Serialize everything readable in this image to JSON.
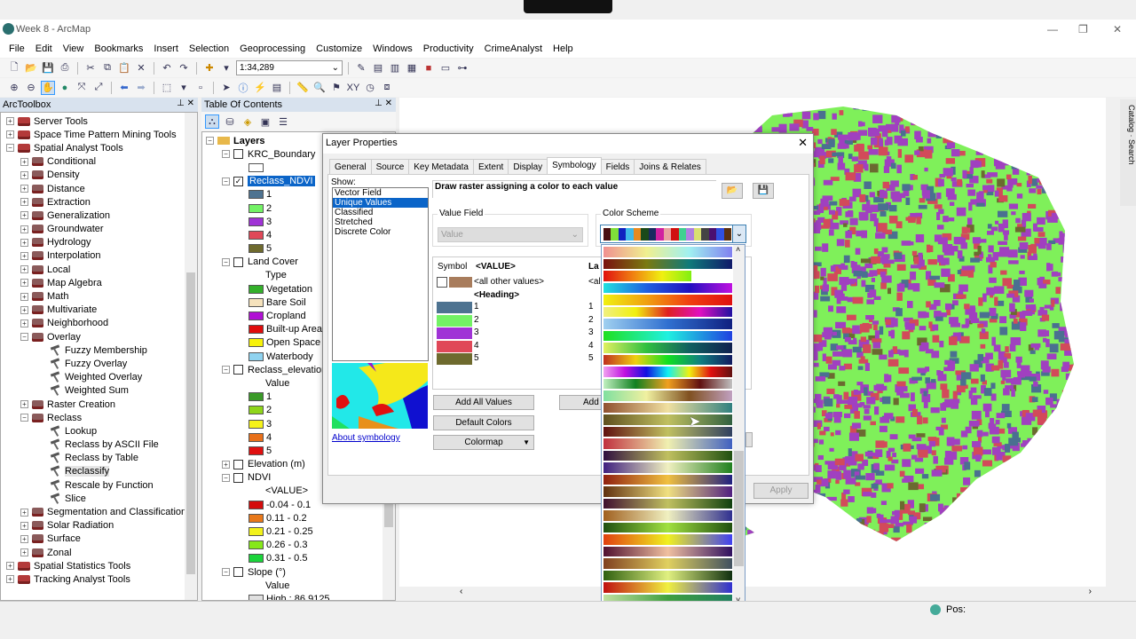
{
  "window": {
    "title": "Week 8 - ArcMap",
    "minimize": "—",
    "restore": "❐",
    "close": "✕"
  },
  "menu": [
    "File",
    "Edit",
    "View",
    "Bookmarks",
    "Insert",
    "Selection",
    "Geoprocessing",
    "Customize",
    "Windows",
    "Productivity",
    "CrimeAnalyst",
    "Help"
  ],
  "toolbar": {
    "scale": "1:34,289"
  },
  "arctoolbox": {
    "title": "ArcToolbox",
    "items": [
      {
        "label": "Server Tools",
        "level": 0,
        "type": "box",
        "exp": "+"
      },
      {
        "label": "Space Time Pattern Mining Tools",
        "level": 0,
        "type": "box",
        "exp": "+"
      },
      {
        "label": "Spatial Analyst Tools",
        "level": 0,
        "type": "box",
        "exp": "−"
      },
      {
        "label": "Conditional",
        "level": 1,
        "type": "set",
        "exp": "+"
      },
      {
        "label": "Density",
        "level": 1,
        "type": "set",
        "exp": "+"
      },
      {
        "label": "Distance",
        "level": 1,
        "type": "set",
        "exp": "+"
      },
      {
        "label": "Extraction",
        "level": 1,
        "type": "set",
        "exp": "+"
      },
      {
        "label": "Generalization",
        "level": 1,
        "type": "set",
        "exp": "+"
      },
      {
        "label": "Groundwater",
        "level": 1,
        "type": "set",
        "exp": "+"
      },
      {
        "label": "Hydrology",
        "level": 1,
        "type": "set",
        "exp": "+"
      },
      {
        "label": "Interpolation",
        "level": 1,
        "type": "set",
        "exp": "+"
      },
      {
        "label": "Local",
        "level": 1,
        "type": "set",
        "exp": "+"
      },
      {
        "label": "Map Algebra",
        "level": 1,
        "type": "set",
        "exp": "+"
      },
      {
        "label": "Math",
        "level": 1,
        "type": "set",
        "exp": "+"
      },
      {
        "label": "Multivariate",
        "level": 1,
        "type": "set",
        "exp": "+"
      },
      {
        "label": "Neighborhood",
        "level": 1,
        "type": "set",
        "exp": "+"
      },
      {
        "label": "Overlay",
        "level": 1,
        "type": "set",
        "exp": "−"
      },
      {
        "label": "Fuzzy Membership",
        "level": 2,
        "type": "tool"
      },
      {
        "label": "Fuzzy Overlay",
        "level": 2,
        "type": "tool"
      },
      {
        "label": "Weighted Overlay",
        "level": 2,
        "type": "tool"
      },
      {
        "label": "Weighted Sum",
        "level": 2,
        "type": "tool"
      },
      {
        "label": "Raster Creation",
        "level": 1,
        "type": "set",
        "exp": "+"
      },
      {
        "label": "Reclass",
        "level": 1,
        "type": "set",
        "exp": "−"
      },
      {
        "label": "Lookup",
        "level": 2,
        "type": "tool"
      },
      {
        "label": "Reclass by ASCII File",
        "level": 2,
        "type": "tool"
      },
      {
        "label": "Reclass by Table",
        "level": 2,
        "type": "tool"
      },
      {
        "label": "Reclassify",
        "level": 2,
        "type": "tool",
        "hl": true
      },
      {
        "label": "Rescale by Function",
        "level": 2,
        "type": "tool"
      },
      {
        "label": "Slice",
        "level": 2,
        "type": "tool"
      },
      {
        "label": "Segmentation and Classification",
        "level": 1,
        "type": "set",
        "exp": "+"
      },
      {
        "label": "Solar Radiation",
        "level": 1,
        "type": "set",
        "exp": "+"
      },
      {
        "label": "Surface",
        "level": 1,
        "type": "set",
        "exp": "+"
      },
      {
        "label": "Zonal",
        "level": 1,
        "type": "set",
        "exp": "+"
      },
      {
        "label": "Spatial Statistics Tools",
        "level": 0,
        "type": "box",
        "exp": "+"
      },
      {
        "label": "Tracking Analyst Tools",
        "level": 0,
        "type": "box",
        "exp": "+"
      }
    ]
  },
  "toc": {
    "title": "Table Of Contents",
    "root": "Layers",
    "items": [
      {
        "kind": "layer",
        "label": "KRC_Boundary",
        "checked": false
      },
      {
        "kind": "sym",
        "label": "",
        "color": "#ffffff"
      },
      {
        "kind": "layer",
        "label": "Reclass_NDVI",
        "checked": true,
        "selected": true
      },
      {
        "kind": "sym",
        "label": "1",
        "color": "#4e7391"
      },
      {
        "kind": "sym",
        "label": "2",
        "color": "#73f265"
      },
      {
        "kind": "sym",
        "label": "3",
        "color": "#a033d6"
      },
      {
        "kind": "sym",
        "label": "4",
        "color": "#e04858"
      },
      {
        "kind": "sym",
        "label": "5",
        "color": "#6e6a2e"
      },
      {
        "kind": "layer",
        "label": "Land Cover",
        "checked": false
      },
      {
        "kind": "head",
        "label": "Type"
      },
      {
        "kind": "sym",
        "label": "Vegetation",
        "color": "#33b02a"
      },
      {
        "kind": "sym",
        "label": "Bare Soil",
        "color": "#f5e2bc"
      },
      {
        "kind": "sym",
        "label": "Cropland",
        "color": "#b00fd4"
      },
      {
        "kind": "sym",
        "label": "Built-up Area",
        "color": "#e00c0c"
      },
      {
        "kind": "sym",
        "label": "Open Space",
        "color": "#f7f20a"
      },
      {
        "kind": "sym",
        "label": "Waterbody",
        "color": "#8fd3f0"
      },
      {
        "kind": "layer",
        "label": "Reclass_elevation",
        "checked": false
      },
      {
        "kind": "head",
        "label": "Value"
      },
      {
        "kind": "sym",
        "label": "1",
        "color": "#3a9a28"
      },
      {
        "kind": "sym",
        "label": "2",
        "color": "#8fd61a"
      },
      {
        "kind": "sym",
        "label": "3",
        "color": "#f5f21a"
      },
      {
        "kind": "sym",
        "label": "4",
        "color": "#e8701a"
      },
      {
        "kind": "sym",
        "label": "5",
        "color": "#e01010"
      },
      {
        "kind": "layerc",
        "label": "Elevation (m)",
        "checked": false
      },
      {
        "kind": "layer",
        "label": "NDVI",
        "checked": false
      },
      {
        "kind": "head",
        "label": "<VALUE>"
      },
      {
        "kind": "sym",
        "label": "-0.04 - 0.1",
        "color": "#d40c0c"
      },
      {
        "kind": "sym",
        "label": "0.11 - 0.2",
        "color": "#e8781a"
      },
      {
        "kind": "sym",
        "label": "0.21 - 0.25",
        "color": "#f2f21a"
      },
      {
        "kind": "sym",
        "label": "0.26 - 0.3",
        "color": "#86e81a"
      },
      {
        "kind": "sym",
        "label": "0.31 - 0.5",
        "color": "#1ad43a"
      },
      {
        "kind": "layer",
        "label": "Slope (°)",
        "checked": false
      },
      {
        "kind": "head",
        "label": "Value"
      },
      {
        "kind": "sym",
        "label": "High : 86.9125",
        "color": "#e0e0e0"
      }
    ]
  },
  "dialog": {
    "title": "Layer Properties",
    "close": "✕",
    "tabs": [
      "General",
      "Source",
      "Key Metadata",
      "Extent",
      "Display",
      "Symbology",
      "Fields",
      "Joins & Relates"
    ],
    "active_tab": "Symbology",
    "show_label": "Show:",
    "show_items": [
      "Vector Field",
      "Unique Values",
      "Classified",
      "Stretched",
      "Discrete Color"
    ],
    "show_selected": "Unique Values",
    "about_link": "About symbology",
    "description": "Draw raster assigning a color to each value",
    "value_field_label": "Value Field",
    "value_field": "Value",
    "color_scheme_label": "Color Scheme",
    "table_headers": {
      "symbol": "Symbol",
      "value": "<VALUE>",
      "label": "La"
    },
    "all_other": "<all other values>",
    "all_other_label": "<all",
    "heading": "<Heading>",
    "rows": [
      {
        "value": "1",
        "label": "1",
        "color": "#4e7391"
      },
      {
        "value": "2",
        "label": "2",
        "color": "#73f265"
      },
      {
        "value": "3",
        "label": "3",
        "color": "#a033d6"
      },
      {
        "value": "4",
        "label": "4",
        "color": "#e04858"
      },
      {
        "value": "5",
        "label": "5",
        "color": "#6e6a2e"
      }
    ],
    "buttons": {
      "add_all": "Add All Values",
      "add": "Add V",
      "default_colors": "Default Colors",
      "colormap": "Colormap",
      "apply": "Apply"
    },
    "scheme_colors": [
      "#4a1010",
      "#7fe03a",
      "#1020c0",
      "#40b8e8",
      "#e88a20",
      "#1a4a1a",
      "#1a2a60",
      "#d020a0",
      "#e8a0a0",
      "#d01010",
      "#40d090",
      "#b080e0",
      "#d8e070",
      "#444",
      "#4a1070",
      "#3050e0",
      "#5a3010"
    ],
    "ramps": [
      [
        "#f09090",
        "#f0f090",
        "#a0f0f0",
        "#8080f0"
      ],
      [
        "#7a1010",
        "#7a7a10",
        "#107a7a",
        "#101a6a"
      ],
      [
        "#e01010",
        "#f08010",
        "#f0f010",
        "#80f010"
      ],
      [
        "#20e0e0",
        "#2060e0",
        "#2010c0",
        "#c010e0"
      ],
      [
        "#f0f010",
        "#f0a010",
        "#f04010",
        "#e01010"
      ],
      [
        "#f0f080",
        "#f0f010",
        "#e02020",
        "#e010c0",
        "#2010a0"
      ],
      [
        "#a0d0f0",
        "#3070d0",
        "#102080"
      ],
      [
        "#20e020",
        "#20f0e0",
        "#2040e0"
      ],
      [
        "#e0f060",
        "#30c040",
        "#106060",
        "#102050"
      ],
      [
        "#c03020",
        "#f0d010",
        "#10e020",
        "#108080",
        "#101a60"
      ],
      [
        "#f0a0f0",
        "#c010e0",
        "#1010e0",
        "#10f0f0",
        "#f0f010",
        "#e01010",
        "#601010"
      ],
      [
        "#c0f0c0",
        "#108020",
        "#f0a020",
        "#601010",
        "#c0c0c0"
      ],
      [
        "#80e0a0",
        "#f0f0a0",
        "#805020",
        "#c0a0c0"
      ],
      [
        "#905030",
        "#f0e0a0",
        "#308080"
      ],
      [
        "#605020",
        "#c0c060",
        "#306040"
      ],
      [
        "#601010",
        "#c0c060",
        "#304060"
      ],
      [
        "#c03040",
        "#f0f0b0",
        "#4060c0"
      ],
      [
        "#301040",
        "#c0c060",
        "#205010"
      ],
      [
        "#402080",
        "#f0f0c0",
        "#208020"
      ],
      [
        "#902010",
        "#f0c040",
        "#202080"
      ],
      [
        "#603010",
        "#f0e080",
        "#502080"
      ],
      [
        "#401030",
        "#c0c060",
        "#104010"
      ],
      [
        "#a06020",
        "#f0f0c0",
        "#303090"
      ],
      [
        "#205010",
        "#a0e040",
        "#205010"
      ],
      [
        "#e04010",
        "#f0f020",
        "#4040f0"
      ],
      [
        "#501030",
        "#f0c0a0",
        "#301060"
      ],
      [
        "#804020",
        "#e0d060",
        "#405060"
      ],
      [
        "#306010",
        "#e0f080",
        "#103010"
      ],
      [
        "#c01010",
        "#f0f040",
        "#3030d0"
      ],
      [
        "#c0e0a0",
        "#40a040",
        "#208060"
      ],
      [
        "#406030",
        "#c0c040",
        "#40c040"
      ],
      [
        "#e0a030",
        "#e02080",
        "#2030c0"
      ],
      [
        "#202040",
        "#d0d0d0",
        "#4040c0"
      ]
    ]
  },
  "status": {
    "position_label": "Pos:"
  },
  "map": {
    "fill": "#7ff05a",
    "speckle": [
      "#a040c0",
      "#d24a5a",
      "#4a7090",
      "#6b6a30"
    ]
  }
}
